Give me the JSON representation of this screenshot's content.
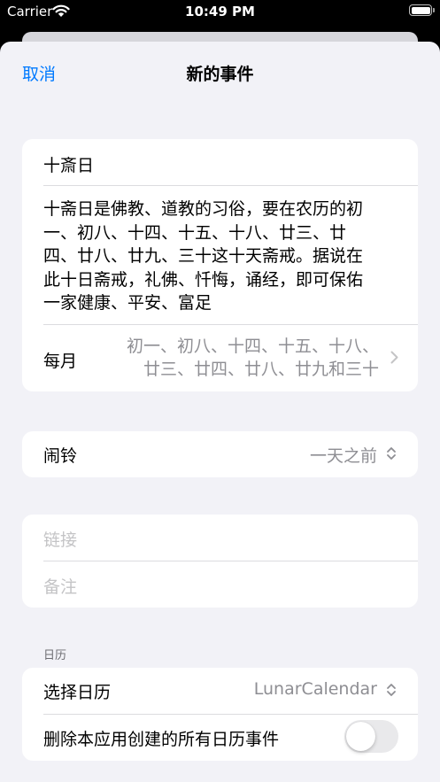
{
  "status_bar": {
    "carrier": "Carrier",
    "time": "10:49 PM"
  },
  "nav": {
    "cancel": "取消",
    "title": "新的事件"
  },
  "event": {
    "title": "十斎日",
    "description_lines": [
      "十斋日是佛教、道教的习俗，要在农历的初",
      "一、初八、十四、十五、十八、廿三、廿",
      "四、廿八、廿九、三十这十天斋戒。据说在",
      "此十日斋戒，礼佛、忏悔，诵经，即可保佑",
      "一家健康、平安、富足"
    ],
    "repeat_label": "每月",
    "repeat_value_lines": [
      "初一、初八、十四、十五、十八、",
      "廿三、廿四、廿八、廿九和三十"
    ]
  },
  "alarm": {
    "label": "闹铃",
    "value": "一天之前"
  },
  "extra": {
    "link_placeholder": "链接",
    "notes_placeholder": "备注"
  },
  "calendar": {
    "section_header": "日历",
    "select_label": "选择日历",
    "select_value": "LunarCalendar",
    "delete_label": "删除本应用创建的所有日历事件",
    "delete_toggle_on": false
  },
  "colors": {
    "accent": "#007aff",
    "background": "#f2f2f7",
    "secondary_text": "#8e8e93"
  }
}
